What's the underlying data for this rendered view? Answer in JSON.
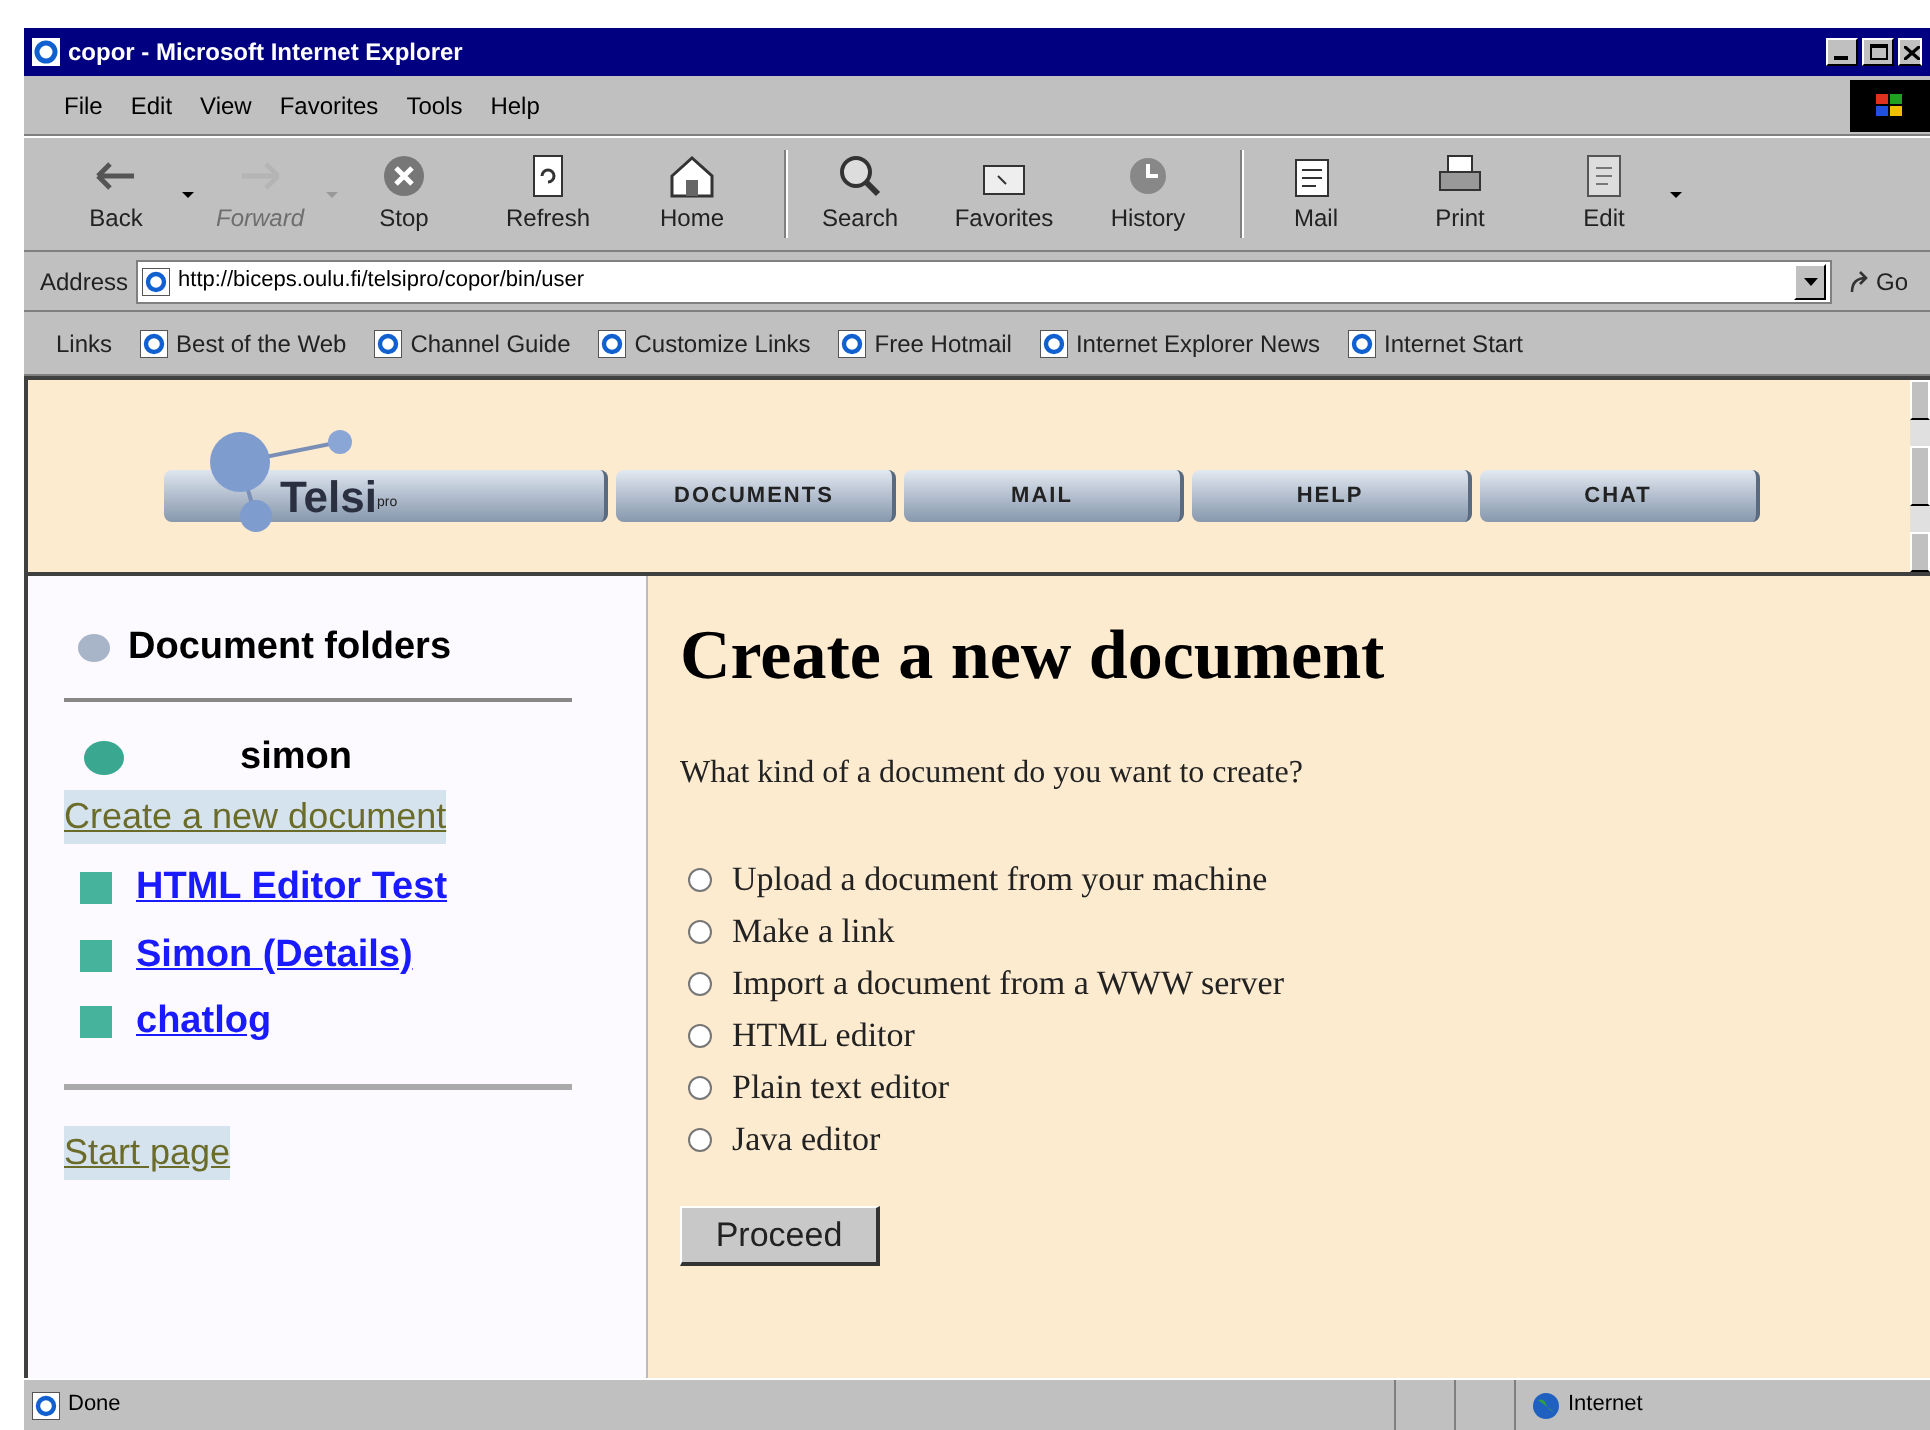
{
  "window": {
    "title": "copor - Microsoft Internet Explorer"
  },
  "menu": [
    "File",
    "Edit",
    "View",
    "Favorites",
    "Tools",
    "Help"
  ],
  "toolbar": [
    {
      "label": "Back",
      "kind": "back",
      "disabled": false,
      "dropdown": true
    },
    {
      "label": "Forward",
      "kind": "forward",
      "disabled": true,
      "dropdown": true
    },
    {
      "label": "Stop",
      "kind": "stop",
      "disabled": false,
      "dropdown": false
    },
    {
      "label": "Refresh",
      "kind": "refresh",
      "disabled": false,
      "dropdown": false
    },
    {
      "label": "Home",
      "kind": "home",
      "disabled": false,
      "dropdown": false
    },
    {
      "label": "Search",
      "kind": "search",
      "disabled": false,
      "dropdown": false
    },
    {
      "label": "Favorites",
      "kind": "favorites",
      "disabled": false,
      "dropdown": false
    },
    {
      "label": "History",
      "kind": "history",
      "disabled": false,
      "dropdown": false
    },
    {
      "label": "Mail",
      "kind": "mail",
      "disabled": false,
      "dropdown": false
    },
    {
      "label": "Print",
      "kind": "print",
      "disabled": false,
      "dropdown": false
    },
    {
      "label": "Edit",
      "kind": "edit",
      "disabled": false,
      "dropdown": true
    }
  ],
  "address": {
    "label": "Address",
    "value": "http://biceps.oulu.fi/telsipro/copor/bin/user",
    "go": "Go"
  },
  "links": {
    "label": "Links",
    "items": [
      "Best of the Web",
      "Channel Guide",
      "Customize Links",
      "Free Hotmail",
      "Internet Explorer News",
      "Internet Start"
    ]
  },
  "site_nav": {
    "logo": {
      "name": "Telsi",
      "suffix": "pro"
    },
    "buttons": [
      "DOCUMENTS",
      "MAIL",
      "HELP",
      "CHAT"
    ]
  },
  "sidebar": {
    "title": "Document folders",
    "user": "simon",
    "create_link": "Create a new document",
    "documents": [
      "HTML Editor Test",
      "Simon (Details)",
      "chatlog"
    ],
    "start_link": "Start page"
  },
  "main": {
    "heading": "Create a new document",
    "question": "What kind of a document do you want to create?",
    "options": [
      {
        "label": "Upload a document from your machine",
        "selected": false
      },
      {
        "label": "Make a link",
        "selected": false
      },
      {
        "label": "Import a document from a WWW server",
        "selected": false
      },
      {
        "label": "HTML editor",
        "selected": false
      },
      {
        "label": "Plain text editor",
        "selected": false
      },
      {
        "label": "Java editor",
        "selected": false
      }
    ],
    "button": "Proceed"
  },
  "status_bar": {
    "text": "Done",
    "zone": "Internet"
  }
}
